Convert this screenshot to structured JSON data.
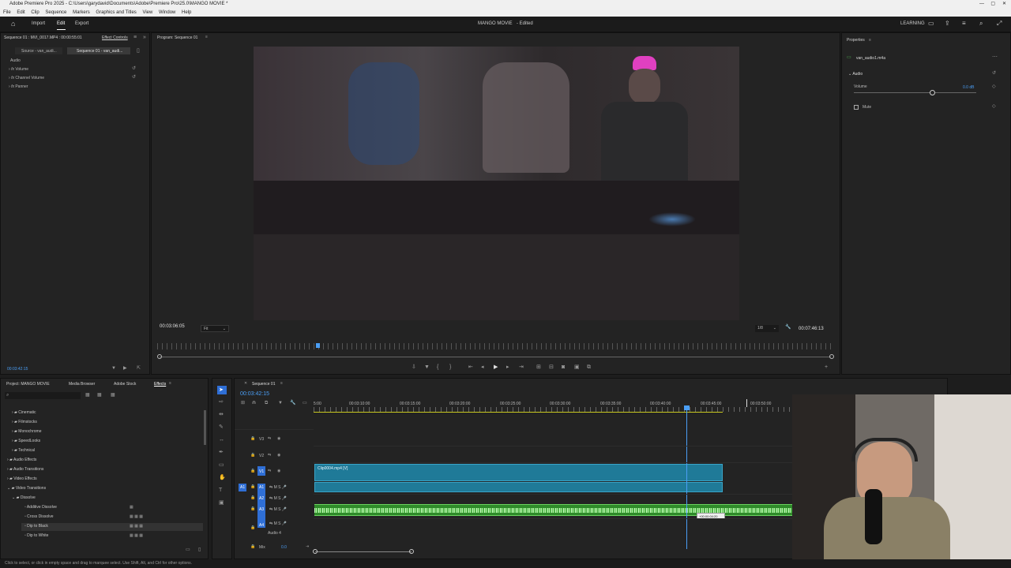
{
  "titlebar": {
    "title": "Adobe Premiere Pro 2025 - C:\\Users\\garydavid\\Documents\\Adobe\\Premiere Pro\\25.0\\MANGO MOVIE *"
  },
  "menu": [
    "File",
    "Edit",
    "Clip",
    "Sequence",
    "Markers",
    "Graphics and Titles",
    "View",
    "Window",
    "Help"
  ],
  "header": {
    "import": "Import",
    "edit": "Edit",
    "export": "Export",
    "project": "MANGO MOVIE",
    "status": "- Edited",
    "learning": "LEARNING"
  },
  "effect_controls": {
    "source_label": "Sequence 01 : MVI_0017.MP4 : 00:00:55:01",
    "tab": "Effect Controls",
    "source_btn": "Source - van_audi...",
    "seq_btn": "Sequence 01 - van_audi...",
    "section": "Audio",
    "props": [
      "Volume",
      "Channel Volume",
      "Panner"
    ],
    "timecode": "00:03:42:15"
  },
  "program": {
    "title": "Program: Sequence 01",
    "timecode": "00:03:06:05",
    "fit": "Fit",
    "quality": "1/8",
    "duration": "00:07:46:13"
  },
  "properties": {
    "title": "Properties",
    "clip": "van_audio1.m4a",
    "section": "Audio",
    "volume_label": "Volume",
    "volume_value": "0.0 dB",
    "mute": "Mute"
  },
  "project": {
    "tabs": [
      "Project: MANGO MOVIE",
      "Media Browser",
      "Adobe Stock",
      "Effects"
    ],
    "items": [
      "Cinematic",
      "Filmstocks",
      "Monochrome",
      "SpeedLooks",
      "Technical",
      "Audio Effects",
      "Audio Transitions",
      "Video Effects",
      "Video Transitions",
      "Dissolve",
      "Additive Dissolve",
      "Cross Dissolve",
      "Dip to Black",
      "Dip to White"
    ]
  },
  "timeline": {
    "title": "Sequence 01",
    "timecode": "00:03:42:15",
    "ruler": [
      "5:00",
      "00:03:10:00",
      "00:03:15:00",
      "00:03:20:00",
      "00:03:25:00",
      "00:03:30:00",
      "00:03:35:00",
      "00:03:40:00",
      "00:03:45:00",
      "00:03:50:00"
    ],
    "video_tracks": [
      "V3",
      "V2",
      "V1"
    ],
    "audio_tracks": [
      "A1",
      "A2",
      "A3",
      "A4"
    ],
    "clip_name": "Clip0004.mp4 [V]",
    "audio4": "Audio 4",
    "mix": "Mix",
    "mix_value": "0.0",
    "drag_tooltip": "+00:00:04:20"
  },
  "status": "Click to select, or click in empty space and drag to marquee select. Use Shift, Alt, and Ctrl for other options."
}
